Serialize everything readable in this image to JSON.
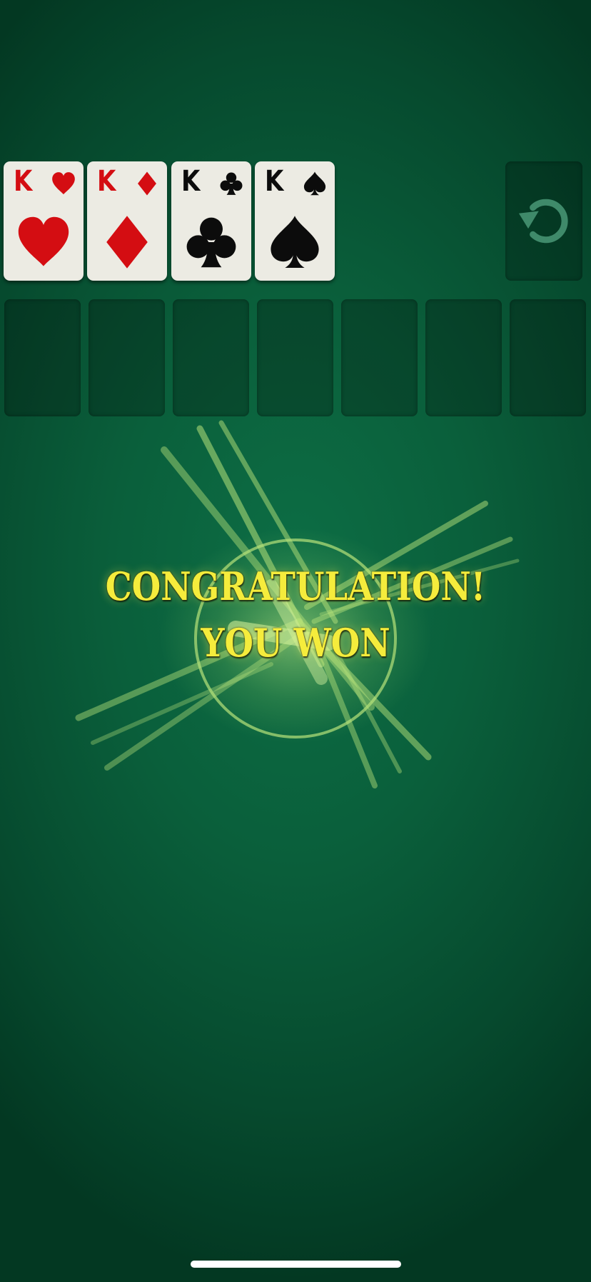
{
  "foundations": [
    {
      "rank": "K",
      "suit": "hearts",
      "color": "#d40d12"
    },
    {
      "rank": "K",
      "suit": "diamonds",
      "color": "#d40d12"
    },
    {
      "rank": "K",
      "suit": "clubs",
      "color": "#0c0c0c"
    },
    {
      "rank": "K",
      "suit": "spades",
      "color": "#0c0c0c"
    }
  ],
  "undo": {
    "icon": "undo-icon"
  },
  "tableau_slot_count": 7,
  "win_message": {
    "line1": "CONGRATULATION!",
    "line2": "YOU WON",
    "color": "#f5ec3c"
  },
  "colors": {
    "felt": "#0a5f3b",
    "card_face": "#ecebe3"
  }
}
